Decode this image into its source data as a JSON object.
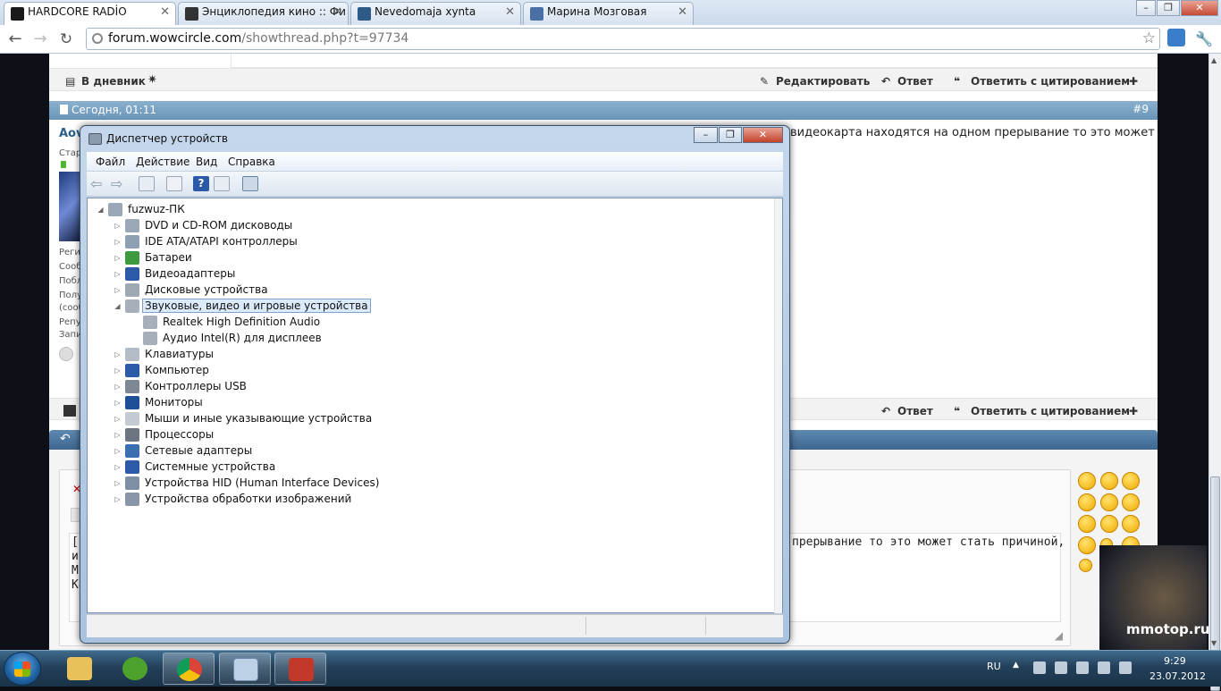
{
  "browser": {
    "tabs": [
      {
        "title": "HARDCORE RADİO",
        "favicon_color": "#1a1a1a"
      },
      {
        "title": "Энциклопедия кино :: Фи",
        "favicon_color": "#333333"
      },
      {
        "title": "Nevedomaja xynta",
        "favicon_color": "#2d5a86"
      },
      {
        "title": "Марина Мозговая",
        "favicon_color": "#4a6fa5"
      }
    ],
    "url_host": "forum.wowcircle.com",
    "url_path": "/showthread.php?t=97734"
  },
  "forum": {
    "top_bar": {
      "diary": "В дневник",
      "edit": "Редактировать",
      "reply": "Ответ",
      "reply_quote": "Ответить с цитированием"
    },
    "post": {
      "date": "Сегодня, 01:11",
      "number": "#9",
      "author_fragment": "Aov",
      "text_fragment": "видеокарта находятся на одном прерывание то это может",
      "sidebar_fragments": [
        "Стар",
        "Реги",
        "Сооб",
        "Побл",
        "Полу",
        "(сооб",
        "Репу",
        "Запи"
      ]
    },
    "bottom_bar": {
      "reply": "Ответ",
      "reply_quote": "Ответить с цитированием"
    },
    "editor": {
      "line1": "[c",
      "line1_right": "прерывание то это может стать причиной,",
      "line2": "ис",
      "line3": "M",
      "line4": "Ка"
    }
  },
  "devmgr": {
    "title": "Диспетчер устройств",
    "menu": [
      "Файл",
      "Действие",
      "Вид",
      "Справка"
    ],
    "root": "fuzwuz-ПК",
    "nodes": [
      {
        "label": "DVD и CD-ROM дисководы",
        "icon": "dvd-drive-icon"
      },
      {
        "label": "IDE ATA/ATAPI контроллеры",
        "icon": "ide-controller-icon"
      },
      {
        "label": "Батареи",
        "icon": "battery-icon"
      },
      {
        "label": "Видеоадаптеры",
        "icon": "display-adapter-icon"
      },
      {
        "label": "Дисковые устройства",
        "icon": "disk-drive-icon"
      },
      {
        "label": "Звуковые, видео и игровые устройства",
        "icon": "speaker-icon",
        "selected": true
      },
      {
        "label": "Realtek High Definition Audio",
        "icon": "speaker-icon",
        "child": true
      },
      {
        "label": "Аудио Intel(R) для дисплеев",
        "icon": "speaker-icon",
        "child": true
      },
      {
        "label": "Клавиатуры",
        "icon": "keyboard-icon"
      },
      {
        "label": "Компьютер",
        "icon": "computer-icon"
      },
      {
        "label": "Контроллеры USB",
        "icon": "usb-icon"
      },
      {
        "label": "Мониторы",
        "icon": "monitor-icon"
      },
      {
        "label": "Мыши и иные указывающие устройства",
        "icon": "mouse-icon"
      },
      {
        "label": "Процессоры",
        "icon": "processor-icon"
      },
      {
        "label": "Сетевые адаптеры",
        "icon": "network-adapter-icon"
      },
      {
        "label": "Системные устройства",
        "icon": "system-device-icon"
      },
      {
        "label": "Устройства HID (Human Interface Devices)",
        "icon": "hid-device-icon"
      },
      {
        "label": "Устройства обработки изображений",
        "icon": "imaging-device-icon"
      }
    ]
  },
  "taskbar": {
    "language": "RU",
    "time": "9:29",
    "date": "23.07.2012"
  },
  "watermark": "mmotop.ru"
}
